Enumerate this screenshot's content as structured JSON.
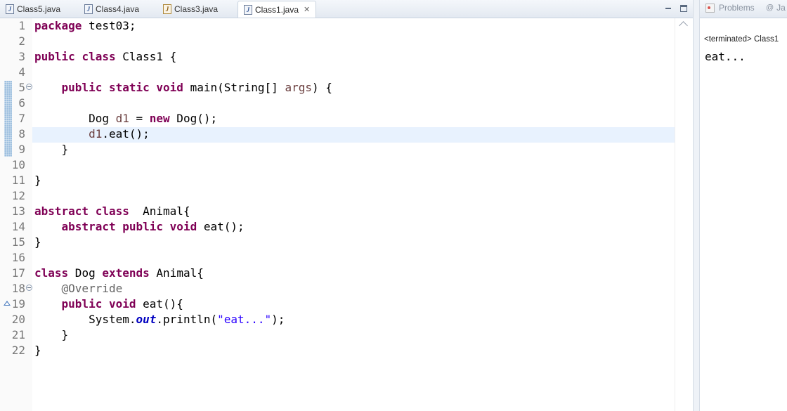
{
  "editor": {
    "tabs": [
      {
        "label": "Class5.java",
        "icon": "java-file-icon",
        "active": false
      },
      {
        "label": "Class4.java",
        "icon": "java-file-icon",
        "active": false
      },
      {
        "label": "Class3.java",
        "icon": "java-file-modified-icon",
        "active": false
      },
      {
        "label": "Class1.java",
        "icon": "java-file-icon",
        "active": true,
        "close_glyph": "✕"
      }
    ],
    "window_buttons": {
      "minimize": "minimize-icon",
      "maximize": "maximize-icon"
    },
    "current_line": 8,
    "lines": [
      {
        "n": "1"
      },
      {
        "n": "2"
      },
      {
        "n": "3"
      },
      {
        "n": "4"
      },
      {
        "n": "5"
      },
      {
        "n": "6"
      },
      {
        "n": "7"
      },
      {
        "n": "8"
      },
      {
        "n": "9"
      },
      {
        "n": "10"
      },
      {
        "n": "11"
      },
      {
        "n": "12"
      },
      {
        "n": "13"
      },
      {
        "n": "14"
      },
      {
        "n": "15"
      },
      {
        "n": "16"
      },
      {
        "n": "17"
      },
      {
        "n": "18"
      },
      {
        "n": "19"
      },
      {
        "n": "20"
      },
      {
        "n": "21"
      },
      {
        "n": "22"
      }
    ],
    "tokens": {
      "package_kw": "package",
      "package_name": " test03;",
      "public": "public",
      "class": "class",
      "class1_decl": " Class1 {",
      "static": "static",
      "void": "void",
      "main_sig": " main(String[] ",
      "args": "args",
      "main_end": ") {",
      "dog_type": "Dog ",
      "d1": "d1",
      "assign": " = ",
      "new": "new",
      "dog_ctor": " Dog();",
      "d1_call_var": "d1",
      "eat_call": ".eat();",
      "close_brace": "}",
      "abstract": "abstract",
      "animal_decl": "  Animal{",
      "eat_abstract": " eat();",
      "dog_decl": " Dog ",
      "extends": "extends",
      "animal_ref": " Animal{",
      "override": "@Override",
      "eat_impl": " eat(){",
      "system": "System.",
      "out": "out",
      "println_open": ".println(",
      "eat_str": "\"eat...\"",
      "println_close": ");"
    }
  },
  "console": {
    "tabs": [
      {
        "label": "Problems",
        "icon": "problems-icon"
      },
      {
        "label": "Ja",
        "icon": "javadoc-icon"
      }
    ],
    "title": "<terminated> Class1",
    "output": "eat..."
  }
}
